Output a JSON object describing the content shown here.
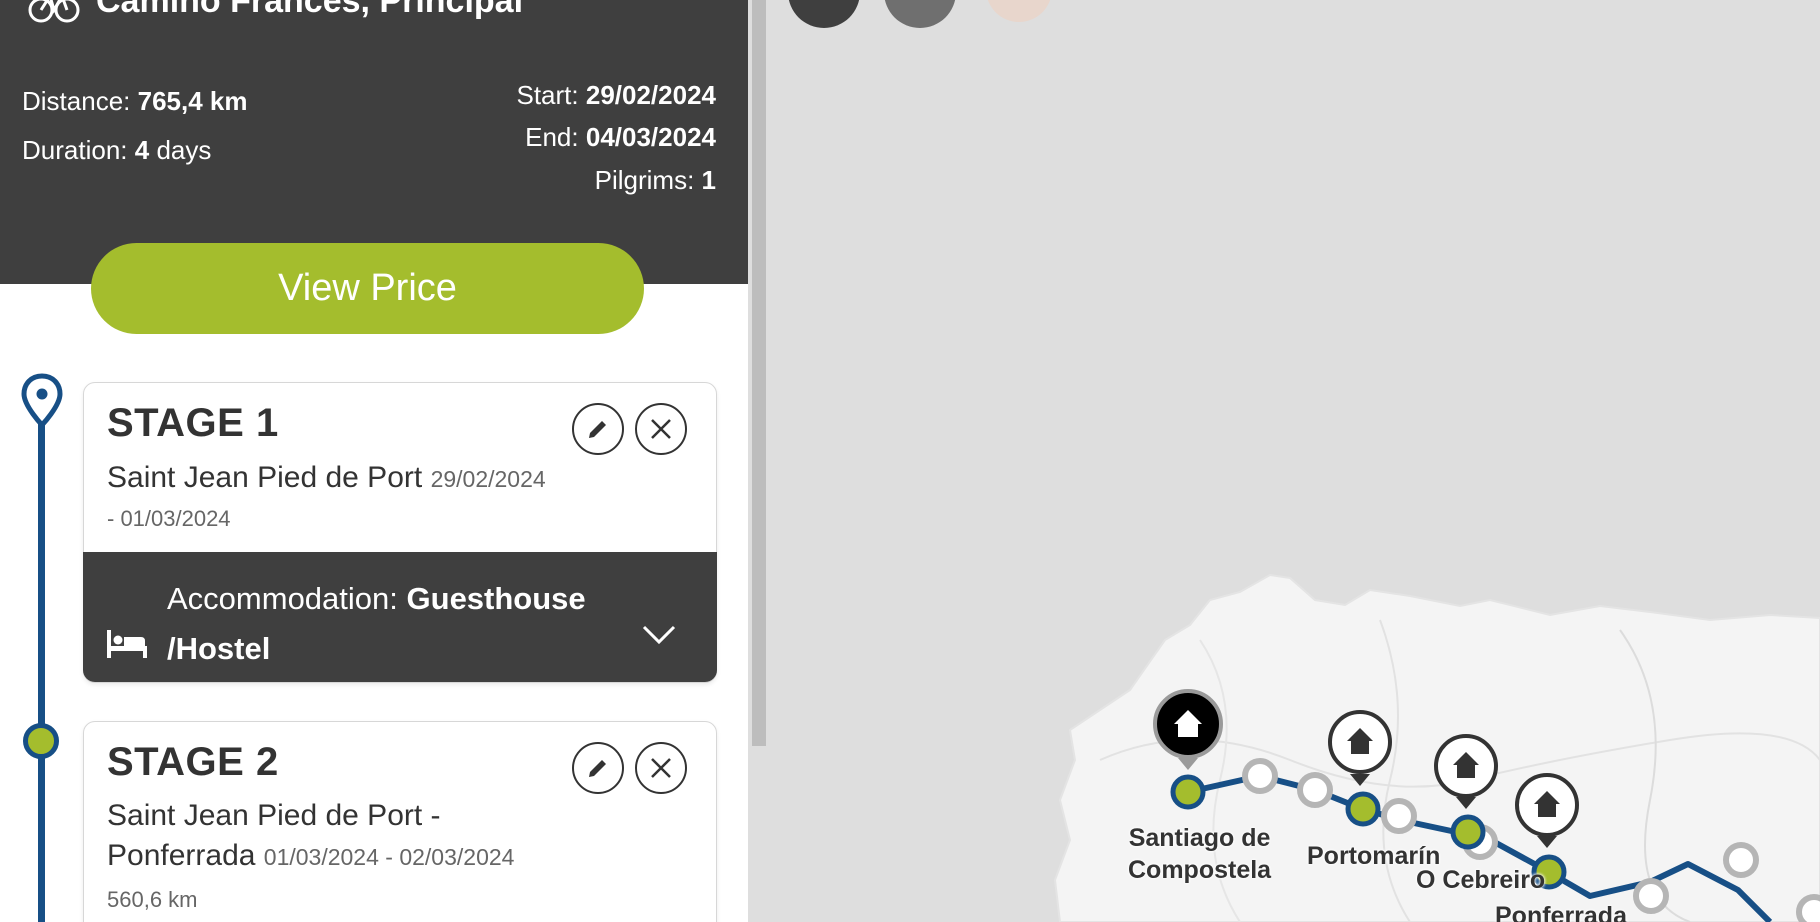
{
  "route": {
    "title": "Camino Francés, Principal",
    "distance_label": "Distance:",
    "distance_value": "765,4 km",
    "duration_label": "Duration:",
    "duration_value": "4",
    "duration_unit": "days",
    "start_label": "Start:",
    "start_value": "29/02/2024",
    "end_label": "End:",
    "end_value": "04/03/2024",
    "pilgrims_label": "Pilgrims:",
    "pilgrims_value": "1",
    "view_price_label": "View Price"
  },
  "stages": [
    {
      "title": "STAGE 1",
      "place": "Saint Jean Pied de Port",
      "date_line1": "29/02/2024",
      "date_line2": "- 01/03/2024",
      "accommodation_label": "Accommodation:",
      "accommodation_value_1": "Guesthouse",
      "accommodation_value_2": "/Hostel"
    },
    {
      "title": "STAGE 2",
      "place_line1": "Saint Jean Pied de Port -",
      "place_line2": "Ponferrada",
      "dates": "01/03/2024 - 02/03/2024",
      "distance": "560,6 km"
    }
  ],
  "map": {
    "labels": {
      "santiago_1": "Santiago de",
      "santiago_2": "Compostela",
      "portomarin": "Portomarín",
      "ocebreiro": "O Cebreiro",
      "ponferrada": "Ponferrada"
    }
  },
  "colors": {
    "header_bg": "#3f3f3f",
    "accent_green": "#a4bd2d",
    "route_blue": "#174f86",
    "map_bg": "#dedede"
  }
}
